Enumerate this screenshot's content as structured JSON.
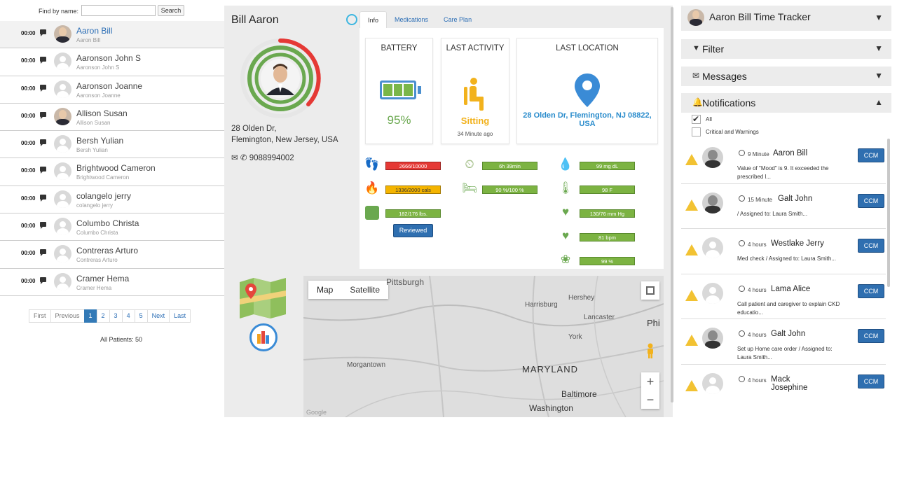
{
  "patient_list": {
    "find_label": "Find by name:",
    "search_placeholder": "",
    "search_button": "Search",
    "patients": [
      {
        "time": "00:00",
        "name": "Aaron Bill",
        "sub": "Aaron Bill",
        "selected": true
      },
      {
        "time": "00:00",
        "name": "Aaronson John S",
        "sub": "Aaronson John S"
      },
      {
        "time": "00:00",
        "name": "Aaronson Joanne",
        "sub": "Aaronson Joanne"
      },
      {
        "time": "00:00",
        "name": "Allison Susan",
        "sub": "Allison Susan"
      },
      {
        "time": "00:00",
        "name": "Bersh Yulian",
        "sub": "Bersh Yulian"
      },
      {
        "time": "00:00",
        "name": "Brightwood Cameron",
        "sub": "Brightwood Cameron"
      },
      {
        "time": "00:00",
        "name": "colangelo jerry",
        "sub": "colangelo jerry"
      },
      {
        "time": "00:00",
        "name": "Columbo Christa",
        "sub": "Columbo Christa"
      },
      {
        "time": "00:00",
        "name": "Contreras Arturo",
        "sub": "Contreras Arturo"
      },
      {
        "time": "00:00",
        "name": "Cramer Hema",
        "sub": "Cramer Hema"
      }
    ],
    "pager": [
      "First",
      "Previous",
      "1",
      "2",
      "3",
      "4",
      "5",
      "Next",
      "Last"
    ],
    "current_page": "1",
    "all_patients": "All Patients: 50"
  },
  "detail": {
    "name": "Bill Aaron",
    "address_line1": "28 Olden Dr,",
    "address_line2": "Flemington, New Jersey, USA",
    "phone": "9088994002",
    "tabs": [
      "Info",
      "Medications",
      "Care Plan"
    ],
    "active_tab": "Info",
    "battery": {
      "title": "BATTERY",
      "value": "95%"
    },
    "activity": {
      "title": "LAST ACTIVITY",
      "value": "Sitting",
      "ago": "34 Minute ago"
    },
    "location": {
      "title": "LAST LOCATION",
      "value": "28 Olden Dr, Flemington, NJ 08822, USA"
    },
    "metrics": {
      "steps": {
        "text": "2666/10000",
        "status": "red",
        "icon": "footprints-icon"
      },
      "calories": {
        "text": "1336/2000 cals",
        "status": "amber",
        "icon": "flame-icon"
      },
      "weight": {
        "text": "182/176 lbs.",
        "status": "green",
        "icon": "scale-icon"
      },
      "sleep_time": {
        "text": "6h 39min",
        "status": "green",
        "icon": "sleep-clock-icon"
      },
      "sleep_quality": {
        "text": "90 %/100 %",
        "status": "green",
        "icon": "bed-icon"
      },
      "glucose": {
        "text": "99 mg dL",
        "status": "green",
        "icon": "blood-drop-icon"
      },
      "temperature": {
        "text": "98 F",
        "status": "green",
        "icon": "thermometer-icon"
      },
      "blood_pressure": {
        "text": "130/76 mm Hg",
        "status": "green",
        "icon": "heart-pulse-icon"
      },
      "heart_rate": {
        "text": "81 bpm",
        "status": "green",
        "icon": "heart-icon"
      },
      "oxygen": {
        "text": "99 %",
        "status": "green",
        "icon": "lungs-icon"
      }
    },
    "reviewed_button": "Reviewed",
    "map": {
      "map_button": "Map",
      "satellite_button": "Satellite",
      "labels": [
        "Pittsburgh",
        "Harrisburg",
        "Hershey",
        "Lancaster",
        "Phi",
        "York",
        "Morgantown",
        "MARYLAND",
        "Baltimore",
        "Washington",
        "Google"
      ],
      "zoom_in": "+",
      "zoom_out": "−"
    }
  },
  "right_panel": {
    "tracker_title": "Aaron Bill Time Tracker",
    "filter": "Filter",
    "messages": "Messages",
    "notifications": "Notifications",
    "check_all": "All",
    "check_critical": "Critical and Warnings",
    "items": [
      {
        "when": "9 Minute",
        "who": "Aaron Bill",
        "msg": "Value of \"Mood\" is 9. It exceeded the prescribed l...",
        "button": "CCM",
        "avatar": "photo"
      },
      {
        "when": "15 Minute",
        "who": "Galt John",
        "msg": "/ Assigned to: Laura Smith...",
        "button": "CCM",
        "avatar": "photo"
      },
      {
        "when": "4 hours",
        "who": "Westlake Jerry",
        "msg": "Med check / Assigned to: Laura Smith...",
        "button": "CCM",
        "avatar": "placeholder"
      },
      {
        "when": "4 hours",
        "who": "Lama Alice",
        "msg": "Call patient and caregiver to explain CKD educatio...",
        "button": "CCM",
        "avatar": "placeholder"
      },
      {
        "when": "4 hours",
        "who": "Galt John",
        "msg": "Set up Home care order / Assigned to: Laura Smith...",
        "button": "CCM",
        "avatar": "photo"
      },
      {
        "when": "4 hours",
        "who": "Mack Josephine",
        "msg": "",
        "button": "CCM",
        "avatar": "placeholder"
      }
    ]
  },
  "colors": {
    "accent_blue": "#2f6fb0",
    "link_blue": "#2a6db5",
    "status_green": "#7cb342",
    "status_red": "#e53935",
    "status_amber": "#f4b400"
  }
}
